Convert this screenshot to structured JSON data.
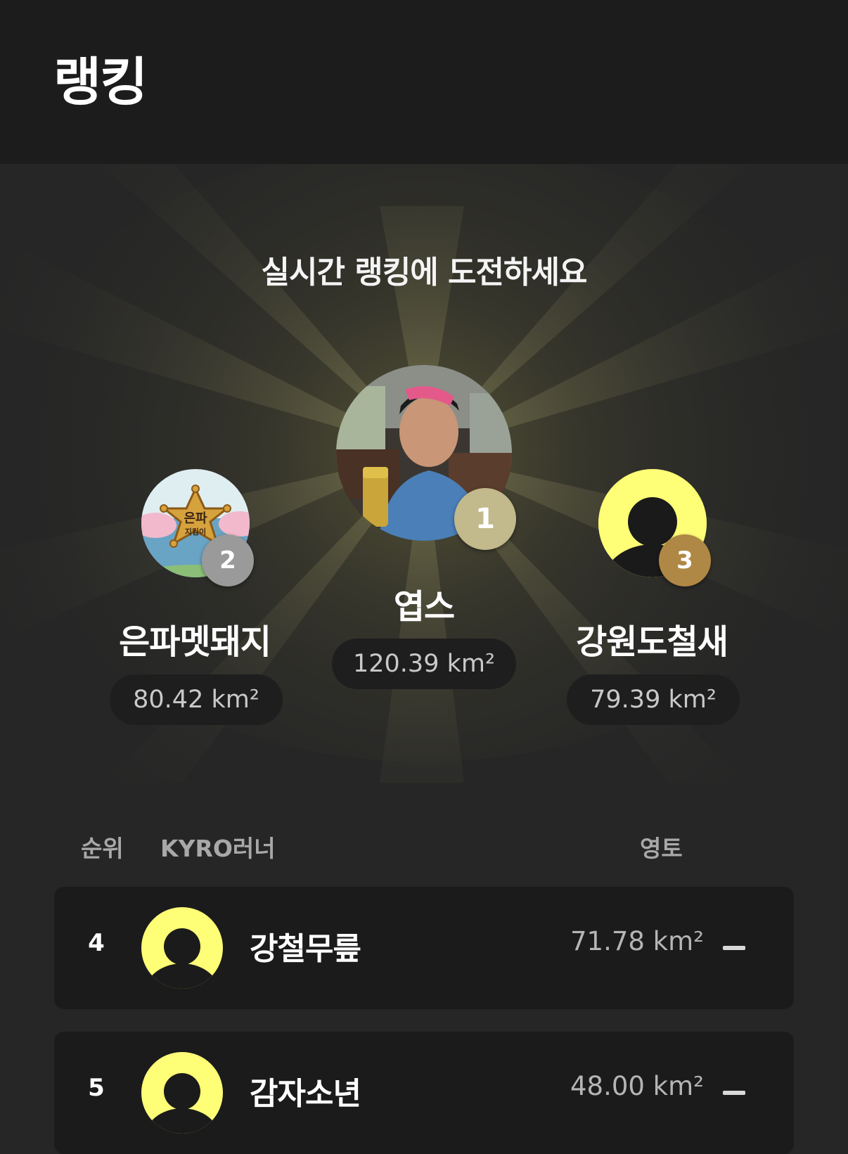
{
  "header": {
    "title": "랭킹"
  },
  "hero": {
    "challenge_text": "실시간 랭킹에 도전하세요"
  },
  "podium": {
    "first": {
      "rank": "1",
      "name": "엽스",
      "score": "120.39 km²",
      "badge_color": "#c2b98c"
    },
    "second": {
      "rank": "2",
      "name": "은파멧돼지",
      "score": "80.42 km²",
      "badge_color": "#9a9a9a",
      "avatar_text_top": "은파",
      "avatar_text_bottom": "지킴이"
    },
    "third": {
      "rank": "3",
      "name": "강원도철새",
      "score": "79.39 km²",
      "badge_color": "#b08845"
    }
  },
  "list": {
    "headers": {
      "rank": "순위",
      "runner": "KYRO러너",
      "territory": "영토"
    },
    "rows": [
      {
        "rank": "4",
        "name": "강철무릎",
        "score": "71.78 km²",
        "trend": "no-change"
      },
      {
        "rank": "5",
        "name": "감자소년",
        "score": "48.00 km²",
        "trend": "no-change"
      }
    ]
  },
  "colors": {
    "accent_yellow": "#ffff77",
    "background": "#262626",
    "header_bg": "#1c1c1c",
    "row_bg": "#1b1b1b"
  },
  "icons": {
    "default_avatar": "person-silhouette-icon",
    "trend": "minus-icon"
  }
}
